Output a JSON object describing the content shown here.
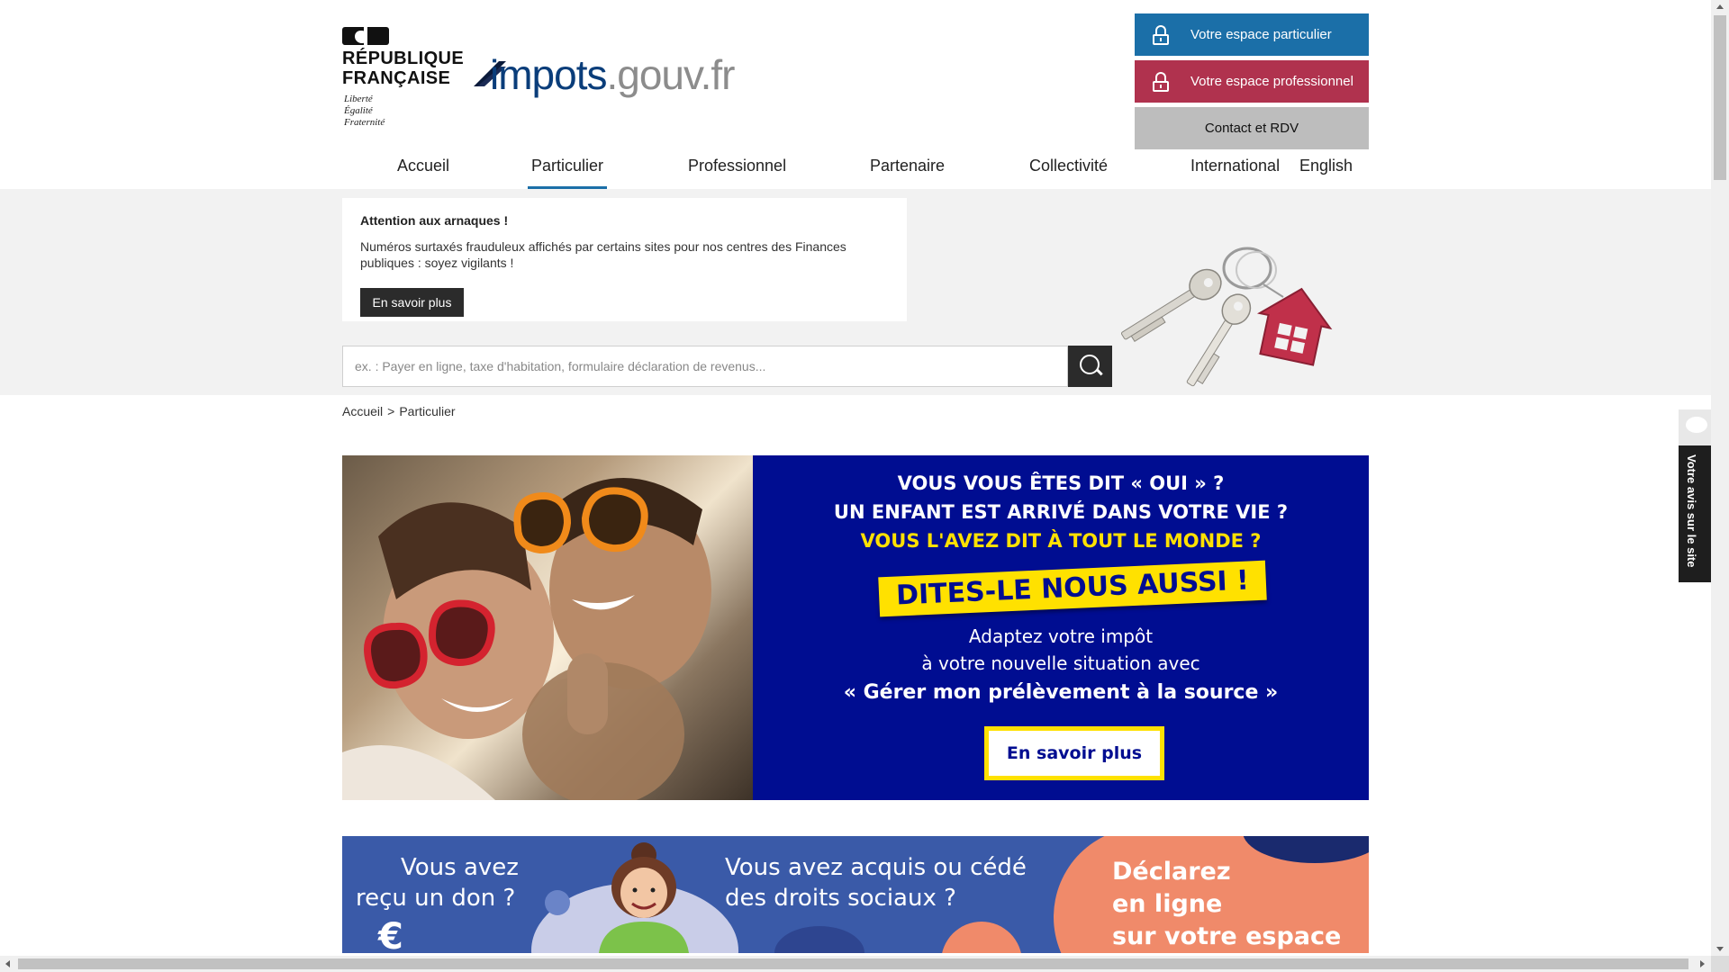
{
  "header": {
    "republique_line1": "RÉPUBLIQUE",
    "republique_line2": "FRANÇAISE",
    "motto_1": "Liberté",
    "motto_2": "Égalité",
    "motto_3": "Fraternité",
    "logo_main": "impots",
    "logo_suffix": ".gouv.fr",
    "btn_particulier": "Votre espace particulier",
    "btn_professionnel": "Votre espace professionnel",
    "btn_contact": "Contact et RDV"
  },
  "nav": {
    "items": [
      "Accueil",
      "Particulier",
      "Professionnel",
      "Partenaire",
      "Collectivité",
      "International",
      "English"
    ],
    "active": "Particulier"
  },
  "alert": {
    "title": "Attention aux arnaques !",
    "text": "Numéros surtaxés frauduleux affichés par certains sites pour nos centres des Finances publiques : soyez vigilants !",
    "button": "En savoir plus"
  },
  "search": {
    "placeholder": "ex. : Payer en ligne, taxe d'habitation, formulaire déclaration de revenus..."
  },
  "breadcrumb": {
    "home": "Accueil",
    "separator": ">",
    "current": "Particulier"
  },
  "banner": {
    "line1": "VOUS VOUS ÊTES DIT « OUI » ?",
    "line2": "UN ENFANT EST ARRIVÉ DANS VOTRE VIE ?",
    "line3": "VOUS L'AVEZ DIT À TOUT LE MONDE ?",
    "ribbon": "DITES-LE NOUS AUSSI !",
    "line4": "Adaptez votre impôt",
    "line5": "à votre nouvelle situation avec",
    "line6": "« Gérer mon prélèvement à la source »",
    "button": "En savoir plus"
  },
  "banner2": {
    "text1a": "Vous avez",
    "text1b": "reçu un don ?",
    "text2a": "Vous avez acquis ou cédé",
    "text2b": "des droits sociaux ?",
    "text3a": "Déclarez",
    "text3b": "en ligne",
    "text3c": "sur votre espace",
    "euro_glyph": "€"
  },
  "feedback": {
    "label": "Votre avis sur le site"
  },
  "colors": {
    "brand_blue": "#1b6fa8",
    "pro_red": "#b0324e",
    "banner_navy": "#000d91",
    "banner_yellow": "#ffe100"
  }
}
